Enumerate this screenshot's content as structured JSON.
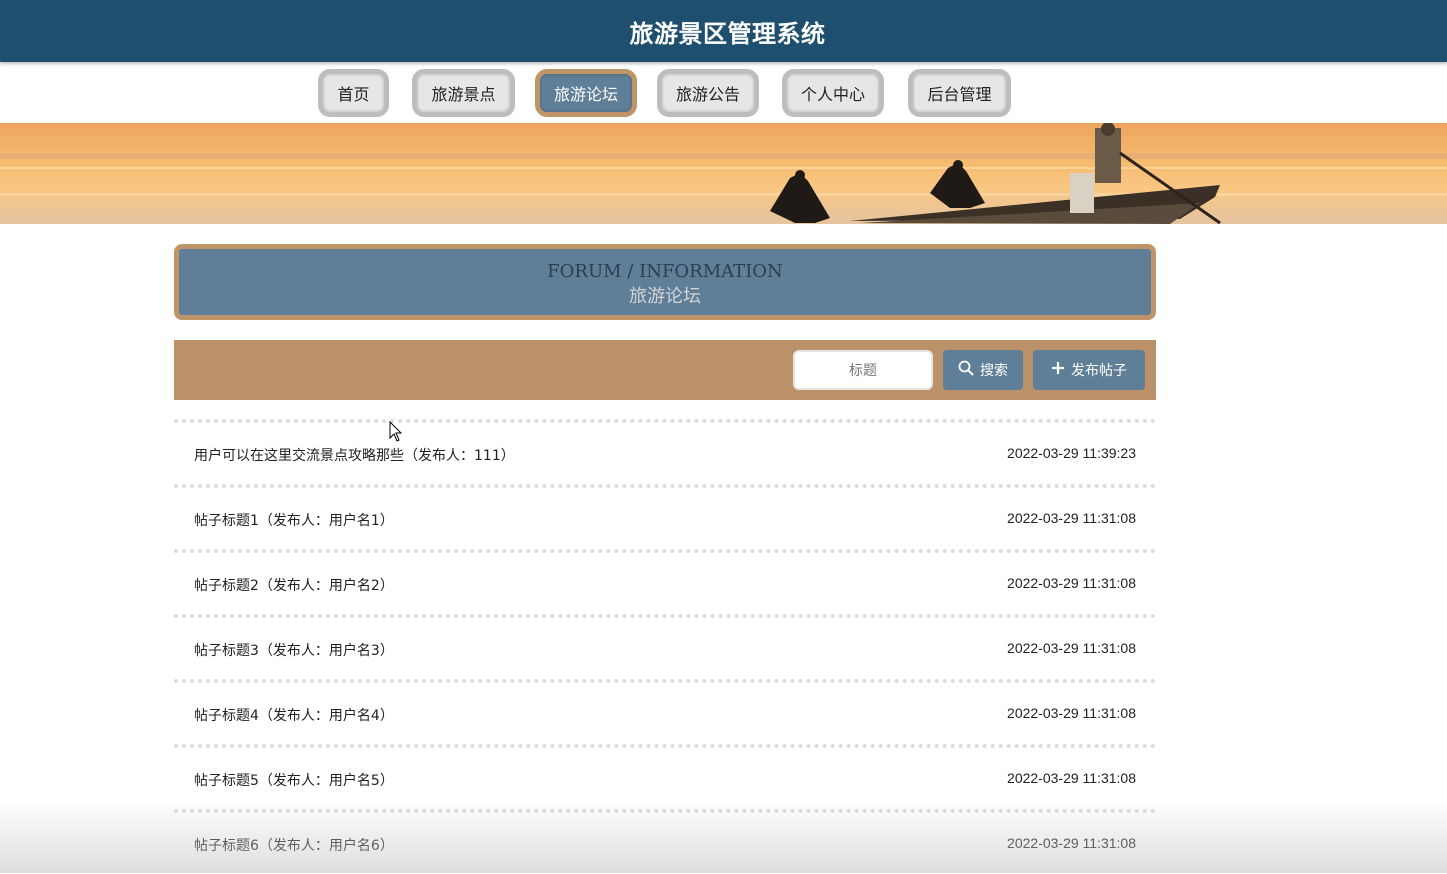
{
  "app": {
    "title": "旅游景区管理系统"
  },
  "nav": {
    "items": [
      {
        "label": "首页",
        "active": false
      },
      {
        "label": "旅游景点",
        "active": false
      },
      {
        "label": "旅游论坛",
        "active": true
      },
      {
        "label": "旅游公告",
        "active": false
      },
      {
        "label": "个人中心",
        "active": false
      },
      {
        "label": "后台管理",
        "active": false
      }
    ]
  },
  "section": {
    "title_en": "FORUM / INFORMATION",
    "title_zh": "旅游论坛"
  },
  "toolbar": {
    "search_placeholder": "标题",
    "search_label": "搜索",
    "post_label": "发布帖子",
    "search_icon": "search-icon",
    "post_icon": "plus-icon"
  },
  "posts": [
    {
      "title": "用户可以在这里交流景点攻略那些（发布人：111）",
      "time": "2022-03-29 11:39:23"
    },
    {
      "title": "帖子标题1（发布人：用户名1）",
      "time": "2022-03-29 11:31:08"
    },
    {
      "title": "帖子标题2（发布人：用户名2）",
      "time": "2022-03-29 11:31:08"
    },
    {
      "title": "帖子标题3（发布人：用户名3）",
      "time": "2022-03-29 11:31:08"
    },
    {
      "title": "帖子标题4（发布人：用户名4）",
      "time": "2022-03-29 11:31:08"
    },
    {
      "title": "帖子标题5（发布人：用户名5）",
      "time": "2022-03-29 11:31:08"
    },
    {
      "title": "帖子标题6（发布人：用户名6）",
      "time": "2022-03-29 11:31:08"
    }
  ],
  "colors": {
    "header": "#1e4f6e",
    "accent_blue": "#5e7f97",
    "accent_tan": "#ba9168"
  }
}
